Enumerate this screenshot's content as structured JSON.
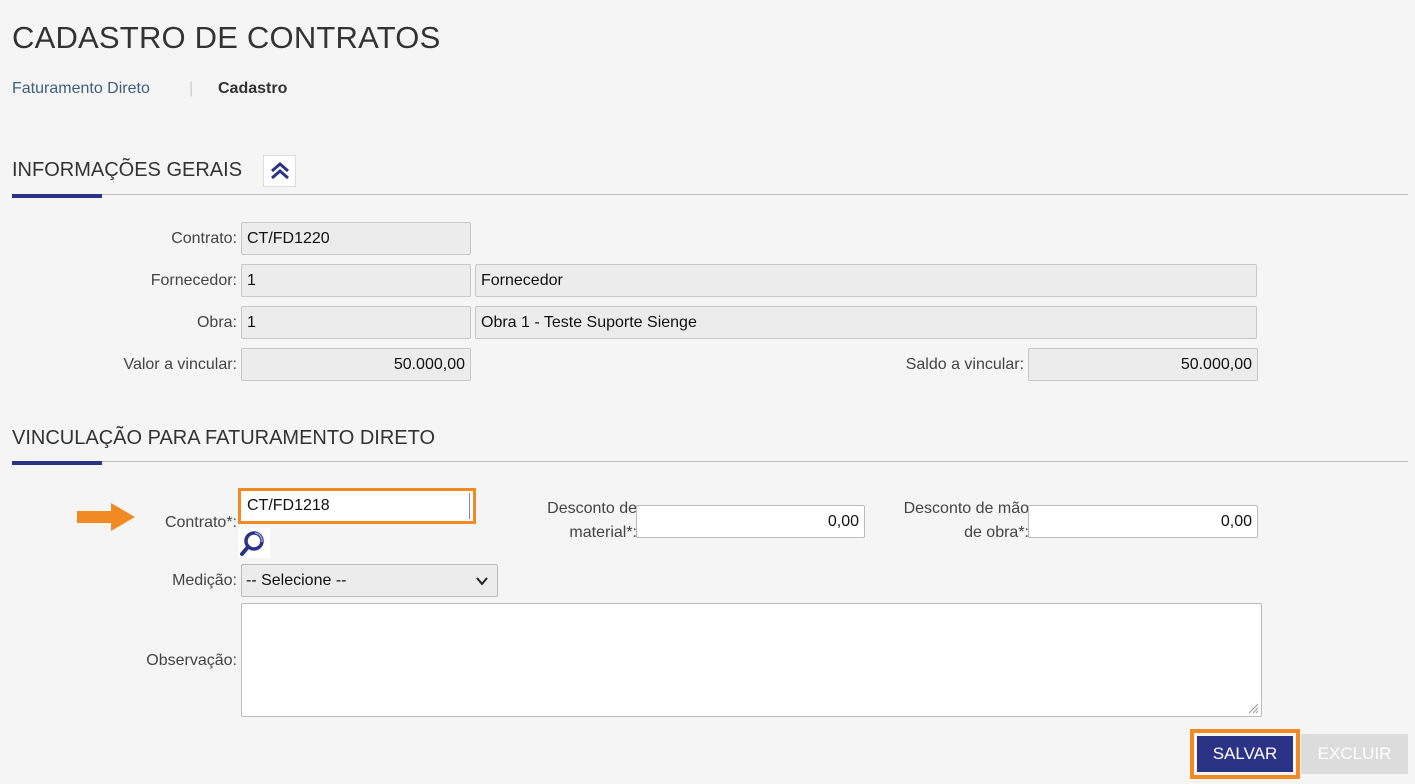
{
  "page": {
    "title": "CADASTRO DE CONTRATOS"
  },
  "breadcrumb": {
    "link": "Faturamento Direto",
    "separator": "|",
    "current": "Cadastro"
  },
  "general": {
    "title": "INFORMAÇÕES GERAIS",
    "contrato_label": "Contrato:",
    "contrato_value": "CT/FD1220",
    "fornecedor_label": "Fornecedor:",
    "fornecedor_code": "1",
    "fornecedor_name": "Fornecedor",
    "obra_label": "Obra:",
    "obra_code": "1",
    "obra_name": "Obra 1 - Teste Suporte Sienge",
    "valor_label": "Valor a vincular:",
    "valor_value": "50.000,00",
    "saldo_label": "Saldo a vincular:",
    "saldo_value": "50.000,00"
  },
  "link_section": {
    "title": "VINCULAÇÃO PARA FATURAMENTO DIRETO",
    "contrato_label": "Contrato*:",
    "contrato_value": "CT/FD1218",
    "desc_material_label_1": "Desconto de",
    "desc_material_label_2": "material*:",
    "desc_material_value": "0,00",
    "desc_mao_label_1": "Desconto de mão",
    "desc_mao_label_2": "de obra*:",
    "desc_mao_value": "0,00",
    "medicao_label": "Medição:",
    "medicao_value": "-- Selecione --",
    "observacao_label": "Observação:"
  },
  "actions": {
    "save": "SALVAR",
    "delete": "EXCLUIR"
  },
  "colors": {
    "accent": "#2b3386",
    "highlight": "#f28a24"
  }
}
